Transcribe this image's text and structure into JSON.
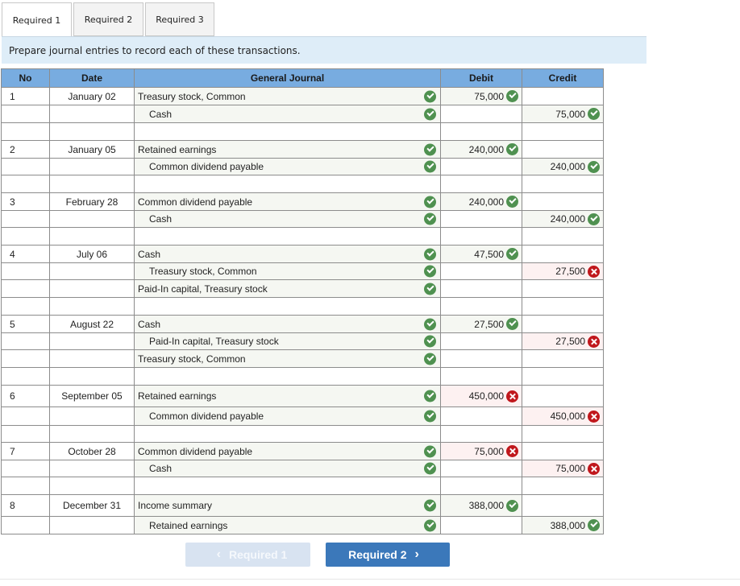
{
  "tabs": [
    {
      "label": "Required 1",
      "active": true
    },
    {
      "label": "Required 2",
      "active": false
    },
    {
      "label": "Required 3",
      "active": false
    }
  ],
  "instruction": "Prepare journal entries to record each of these transactions.",
  "table": {
    "headers": {
      "no": "No",
      "date": "Date",
      "journal": "General Journal",
      "debit": "Debit",
      "credit": "Credit"
    },
    "rows": [
      {
        "no": "1",
        "date": "January 02",
        "account": "Treasury stock, Common",
        "indent": false,
        "account_status": "correct",
        "debit": "75,000",
        "debit_status": "correct",
        "credit": "",
        "credit_status": ""
      },
      {
        "no": "",
        "date": "",
        "account": "Cash",
        "indent": true,
        "account_status": "correct",
        "debit": "",
        "debit_status": "",
        "credit": "75,000",
        "credit_status": "correct"
      },
      {
        "blank": true
      },
      {
        "no": "2",
        "date": "January 05",
        "account": "Retained earnings",
        "indent": false,
        "account_status": "correct",
        "debit": "240,000",
        "debit_status": "correct",
        "credit": "",
        "credit_status": ""
      },
      {
        "no": "",
        "date": "",
        "account": "Common dividend payable",
        "indent": true,
        "account_status": "correct",
        "debit": "",
        "debit_status": "",
        "credit": "240,000",
        "credit_status": "correct"
      },
      {
        "blank": true
      },
      {
        "no": "3",
        "date": "February 28",
        "account": "Common dividend payable",
        "indent": false,
        "account_status": "correct",
        "debit": "240,000",
        "debit_status": "correct",
        "credit": "",
        "credit_status": ""
      },
      {
        "no": "",
        "date": "",
        "account": "Cash",
        "indent": true,
        "account_status": "correct",
        "debit": "",
        "debit_status": "",
        "credit": "240,000",
        "credit_status": "correct"
      },
      {
        "blank": true
      },
      {
        "no": "4",
        "date": "July 06",
        "account": "Cash",
        "indent": false,
        "account_status": "correct",
        "debit": "47,500",
        "debit_status": "correct",
        "credit": "",
        "credit_status": ""
      },
      {
        "no": "",
        "date": "",
        "account": "Treasury stock, Common",
        "indent": true,
        "account_status": "correct",
        "debit": "",
        "debit_status": "",
        "credit": "27,500",
        "credit_status": "incorrect"
      },
      {
        "no": "",
        "date": "",
        "account": "Paid-In capital, Treasury stock",
        "indent": false,
        "account_status": "correct",
        "debit": "",
        "debit_status": "",
        "credit": "",
        "credit_status": ""
      },
      {
        "blank": true
      },
      {
        "no": "5",
        "date": "August 22",
        "account": "Cash",
        "indent": false,
        "account_status": "correct",
        "debit": "27,500",
        "debit_status": "correct",
        "credit": "",
        "credit_status": ""
      },
      {
        "no": "",
        "date": "",
        "account": "Paid-In capital, Treasury stock",
        "indent": true,
        "account_status": "correct",
        "debit": "",
        "debit_status": "",
        "credit": "27,500",
        "credit_status": "incorrect"
      },
      {
        "no": "",
        "date": "",
        "account": "Treasury stock, Common",
        "indent": false,
        "account_status": "correct",
        "debit": "",
        "debit_status": "",
        "credit": "",
        "credit_status": ""
      },
      {
        "blank": true
      },
      {
        "no": "6",
        "date": "September 05",
        "account": "Retained earnings",
        "indent": false,
        "account_status": "correct",
        "debit": "450,000",
        "debit_status": "incorrect",
        "credit": "",
        "credit_status": "",
        "tall": true
      },
      {
        "no": "",
        "date": "",
        "account": "Common dividend payable",
        "indent": true,
        "account_status": "correct",
        "debit": "",
        "debit_status": "",
        "credit": "450,000",
        "credit_status": "incorrect"
      },
      {
        "blank": true
      },
      {
        "no": "7",
        "date": "October 28",
        "account": "Common dividend payable",
        "indent": false,
        "account_status": "correct",
        "debit": "75,000",
        "debit_status": "incorrect",
        "credit": "",
        "credit_status": ""
      },
      {
        "no": "",
        "date": "",
        "account": "Cash",
        "indent": true,
        "account_status": "correct",
        "debit": "",
        "debit_status": "",
        "credit": "75,000",
        "credit_status": "incorrect"
      },
      {
        "blank": true
      },
      {
        "no": "8",
        "date": "December 31",
        "account": "Income summary",
        "indent": false,
        "account_status": "correct",
        "debit": "388,000",
        "debit_status": "correct",
        "credit": "",
        "credit_status": "",
        "tall": true
      },
      {
        "no": "",
        "date": "",
        "account": "Retained earnings",
        "indent": true,
        "account_status": "correct",
        "debit": "",
        "debit_status": "",
        "credit": "388,000",
        "credit_status": "correct"
      }
    ]
  },
  "nav": {
    "prev_label": "Required 1",
    "next_label": "Required 2",
    "prev_icon": "chevron-left-icon",
    "next_icon": "chevron-right-icon"
  },
  "colors": {
    "header_blue": "#78ace0",
    "instruction_bg": "#deedf8",
    "correct_green": "#4f9150",
    "incorrect_red": "#c0171c",
    "next_button": "#3b78ba"
  }
}
